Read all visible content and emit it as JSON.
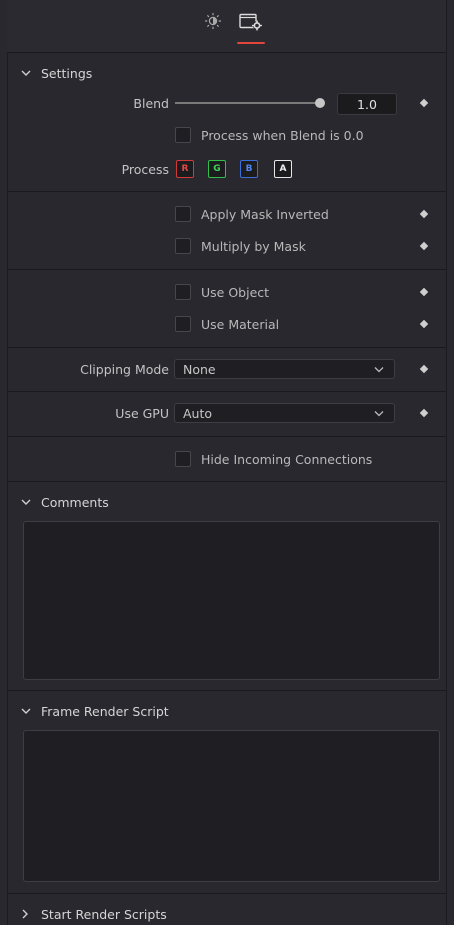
{
  "tabs": [
    {
      "name": "tab-controls",
      "icon": "sun-icon"
    },
    {
      "name": "tab-settings",
      "icon": "gear-window-icon",
      "active": true
    }
  ],
  "settings": {
    "title": "Settings",
    "blend": {
      "label": "Blend",
      "value": "1.0",
      "fraction": 1.0
    },
    "process_when_blend_zero": {
      "label": "Process when Blend is 0.0",
      "checked": false
    },
    "process": {
      "label": "Process",
      "channels": [
        "R",
        "G",
        "B",
        "A"
      ]
    },
    "apply_mask_inverted": {
      "label": "Apply Mask Inverted",
      "checked": false
    },
    "multiply_by_mask": {
      "label": "Multiply by Mask",
      "checked": false
    },
    "use_object": {
      "label": "Use Object",
      "checked": false
    },
    "use_material": {
      "label": "Use Material",
      "checked": false
    },
    "clipping_mode": {
      "label": "Clipping Mode",
      "value": "None"
    },
    "use_gpu": {
      "label": "Use GPU",
      "value": "Auto"
    },
    "hide_incoming": {
      "label": "Hide Incoming Connections",
      "checked": false
    }
  },
  "comments": {
    "title": "Comments",
    "value": ""
  },
  "frame_render_script": {
    "title": "Frame Render Script",
    "value": ""
  },
  "start_render_scripts": {
    "title": "Start Render Scripts"
  },
  "colors": {
    "accent": "#e0463a",
    "red": "#d23a3a",
    "green": "#2fbf4a",
    "blue": "#3a6ed8",
    "alpha": "#e6e6e6"
  }
}
